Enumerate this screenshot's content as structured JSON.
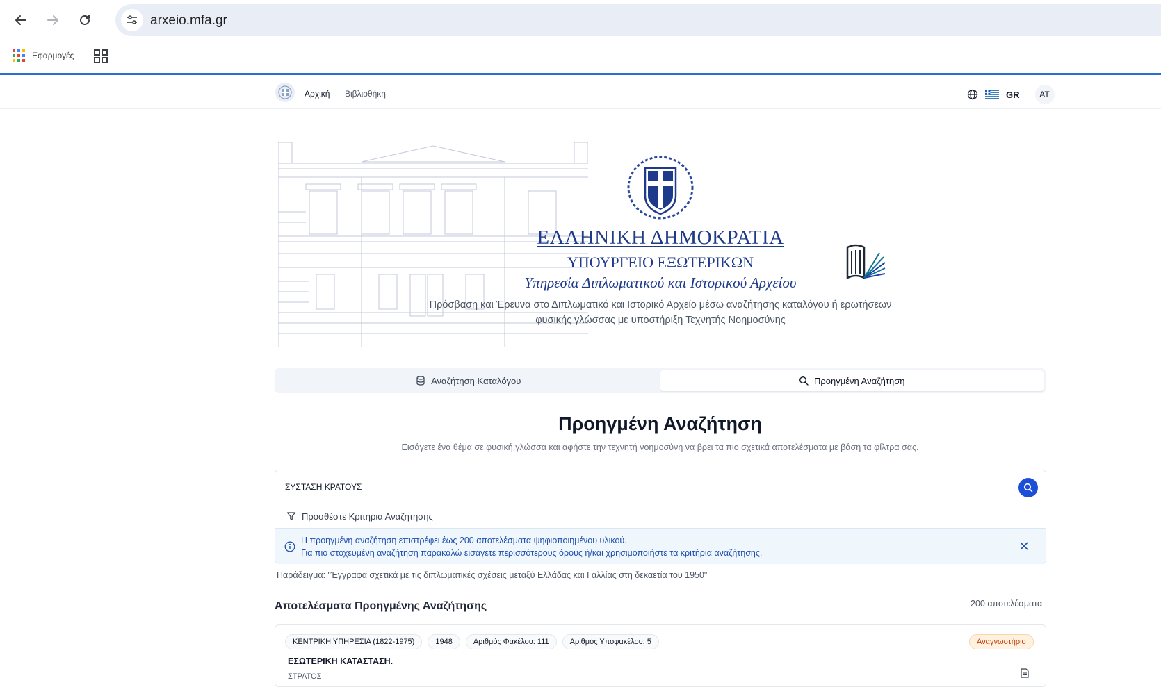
{
  "browser": {
    "url": "arxeio.mfa.gr",
    "bookmarks": {
      "apps_label": "Εφαρμογές"
    }
  },
  "header": {
    "nav": {
      "home": "Αρχική",
      "library": "Βιβλιοθήκη"
    },
    "language": "GR",
    "avatar_initials": "AT"
  },
  "hero": {
    "title_line1": "ΕΛΛΗΝΙΚΗ ΔΗΜΟΚΡΑΤΙΑ",
    "title_line2": "ΥΠΟΥΡΓΕΙΟ ΕΞΩΤΕΡΙΚΩΝ",
    "title_line3": "Υπηρεσία Διπλωματικού και Ιστορικού Αρχείου",
    "description_line1": "Πρόσβαση και Έρευνα στο Διπλωματικό και Ιστορικό Αρχείο μέσω αναζήτησης καταλόγου ή ερωτήσεων",
    "description_line2": "φυσικής γλώσσας με υποστήριξη Τεχνητής Νοημοσύνης"
  },
  "tabs": [
    {
      "label": "Αναζήτηση Καταλόγου",
      "icon": "database-icon",
      "active": false
    },
    {
      "label": "Προηγμένη Αναζήτηση",
      "icon": "search-icon",
      "active": true
    }
  ],
  "advanced": {
    "title": "Προηγμένη Αναζήτηση",
    "subtitle": "Εισάγετε ένα θέμα σε φυσική γλώσσα και αφήστε την τεχνητή νοημοσύνη να βρει τα πιο σχετικά αποτελέσματα με βάση τα φίλτρα σας.",
    "search_value": "ΣΥΣΤΑΣΗ ΚΡΑΤΟΥΣ",
    "filter_label": "Προσθέστε Κριτήρια Αναζήτησης",
    "info_line1": "Η προηγμένη αναζήτηση επιστρέφει έως 200 αποτελέσματα ψηφιοποιημένου υλικού.",
    "info_line2": "Για πιο στοχευμένη αναζήτηση παρακαλώ εισάγετε περισσότερους όρους ή/και χρησιμοποιήστε τα κριτήρια αναζήτησης.",
    "example": "Παράδειγμα: \"Έγγραφα σχετικά με τις διπλωματικές σχέσεις μεταξύ Ελλάδας και Γαλλίας στη δεκαετία του 1950\""
  },
  "results": {
    "title": "Αποτελέσματα Προηγμένης Αναζήτησης",
    "count": "200 αποτελέσματα",
    "items": [
      {
        "badges": [
          "ΚΕΝΤΡΙΚΗ ΥΠΗΡΕΣΙΑ (1822-1975)",
          "1948",
          "Αριθμός Φακέλου: 111",
          "Αριθμός Υποφακέλου: 5"
        ],
        "access": "Αναγνωστήριο",
        "title": "ΕΣΩΤΕΡΙΚΗ ΚΑΤΑΣΤΑΣΗ.",
        "subtitle": "ΣΤΡΑΤΟΣ"
      }
    ]
  },
  "colors": {
    "accent": "#1d4ed8",
    "title_blue": "#1e3a8a",
    "info_bg": "#eff6fc",
    "access_badge": "#c2410c"
  }
}
